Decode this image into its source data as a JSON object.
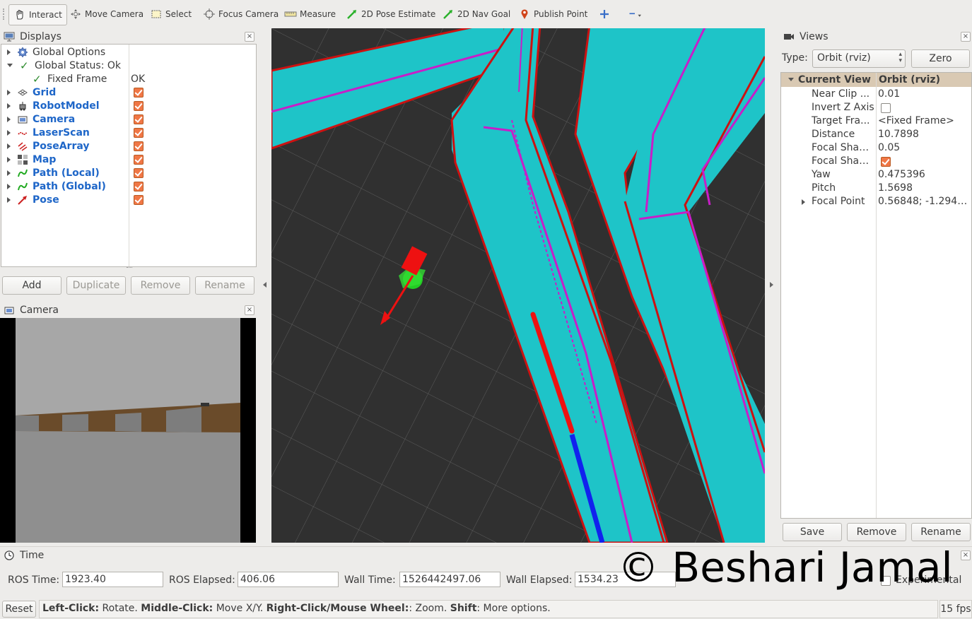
{
  "toolbar": {
    "tools": [
      {
        "label": "Interact",
        "icon": "hand-icon"
      },
      {
        "label": "Move Camera",
        "icon": "move-camera-icon"
      },
      {
        "label": "Select",
        "icon": "select-icon"
      },
      {
        "label": "Focus Camera",
        "icon": "focus-camera-icon"
      },
      {
        "label": "Measure",
        "icon": "ruler-icon"
      },
      {
        "label": "2D Pose Estimate",
        "icon": "green-arrow-icon"
      },
      {
        "label": "2D Nav Goal",
        "icon": "green-arrow-icon"
      },
      {
        "label": "Publish Point",
        "icon": "map-pin-icon"
      }
    ],
    "add_tool_icon": "plus-icon",
    "remove_tool_icon": "minus-icon"
  },
  "displays": {
    "title": "Displays",
    "items": [
      {
        "label": "Global Options",
        "icon": "gear-icon",
        "bold": false
      },
      {
        "label": "Global Status: Ok",
        "icon": "checkmark-icon",
        "bold": false,
        "expanded": true
      },
      {
        "label": "Fixed Frame",
        "icon": "checkmark-icon",
        "value": "OK",
        "child": true
      },
      {
        "label": "Grid",
        "icon": "grid-icon",
        "checked": true
      },
      {
        "label": "RobotModel",
        "icon": "robot-icon",
        "checked": true
      },
      {
        "label": "Camera",
        "icon": "camera-icon",
        "checked": true
      },
      {
        "label": "LaserScan",
        "icon": "laser-icon",
        "checked": true
      },
      {
        "label": "PoseArray",
        "icon": "pose-array-icon",
        "checked": true
      },
      {
        "label": "Map",
        "icon": "map-icon",
        "checked": true
      },
      {
        "label": "Path (Local)",
        "icon": "path-icon",
        "checked": true
      },
      {
        "label": "Path (Global)",
        "icon": "path-icon",
        "checked": true
      },
      {
        "label": "Pose",
        "icon": "pose-icon",
        "checked": true
      }
    ],
    "buttons": {
      "add": "Add",
      "duplicate": "Duplicate",
      "remove": "Remove",
      "rename": "Rename"
    }
  },
  "camera_panel": {
    "title": "Camera"
  },
  "views": {
    "title": "Views",
    "type_label": "Type:",
    "type_value": "Orbit (rviz)",
    "zero_label": "Zero",
    "header_key": "Current View",
    "header_value": "Orbit (rviz)",
    "properties": [
      {
        "key": "Near Clip ...",
        "value": "0.01"
      },
      {
        "key": "Invert Z Axis",
        "value": "",
        "checkbox": false
      },
      {
        "key": "Target Fra...",
        "value": "<Fixed Frame>"
      },
      {
        "key": "Distance",
        "value": "10.7898"
      },
      {
        "key": "Focal Shap...",
        "value": "0.05"
      },
      {
        "key": "Focal Shap...",
        "value": "",
        "checkbox": true
      },
      {
        "key": "Yaw",
        "value": "0.475396"
      },
      {
        "key": "Pitch",
        "value": "1.5698"
      },
      {
        "key": "Focal Point",
        "value": "0.56848; -1.2944...",
        "expandable": true
      }
    ],
    "buttons": {
      "save": "Save",
      "remove": "Remove",
      "rename": "Rename"
    }
  },
  "time": {
    "title": "Time",
    "ros_time_label": "ROS Time:",
    "ros_time": "1923.40",
    "ros_elapsed_label": "ROS Elapsed:",
    "ros_elapsed": "406.06",
    "wall_time_label": "Wall Time:",
    "wall_time": "1526442497.06",
    "wall_elapsed_label": "Wall Elapsed:",
    "wall_elapsed": "1534.23",
    "experimental_label": "Experimental"
  },
  "status": {
    "reset_label": "Reset",
    "hint_left_click": "Left-Click:",
    "hint_rotate": " Rotate. ",
    "hint_middle_click": "Middle-Click:",
    "hint_move": " Move X/Y. ",
    "hint_right_click": "Right-Click/Mouse Wheel:",
    "hint_zoom": ": Zoom. ",
    "hint_shift": "Shift",
    "hint_more": ": More options.",
    "fps": "15 fps"
  },
  "watermark": "© Beshari Jamal",
  "colors": {
    "map_free": "#1ec4c8",
    "map_wall": "#c81ec8",
    "map_edge": "#cc1111",
    "viewport_bg": "#303030",
    "path_global": "#ee1111",
    "path_local": "#1122ee",
    "checkbox": "#f07746",
    "link_blue": "#1e66c8"
  }
}
